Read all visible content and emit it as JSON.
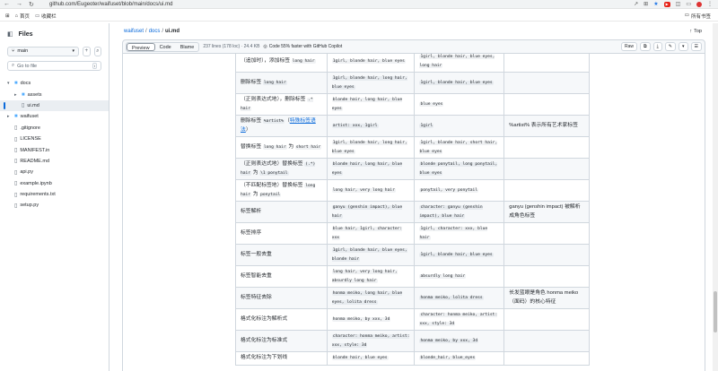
{
  "browser": {
    "url": "github.com/Eugeoter/waifuset/blob/main/docs/ui.md",
    "nav_back": "←",
    "nav_forward": "→",
    "nav_reload": "↻"
  },
  "bookmarks": {
    "home": "首页",
    "favorites": "收藏栏",
    "all": "所有书签"
  },
  "sidebar": {
    "title": "Files",
    "branch": "main",
    "goto_placeholder": "Go to file",
    "goto_kbd": "t",
    "tree": [
      {
        "name": "docs",
        "type": "folder",
        "depth": 0,
        "open": true
      },
      {
        "name": "assets",
        "type": "folder",
        "depth": 1,
        "open": false
      },
      {
        "name": "ui.md",
        "type": "file",
        "depth": 1,
        "selected": true
      },
      {
        "name": "waifuset",
        "type": "folder",
        "depth": 0,
        "open": false
      },
      {
        "name": ".gitignore",
        "type": "file",
        "depth": 0
      },
      {
        "name": "LICENSE",
        "type": "file",
        "depth": 0
      },
      {
        "name": "MANIFEST.in",
        "type": "file",
        "depth": 0
      },
      {
        "name": "README.md",
        "type": "file",
        "depth": 0
      },
      {
        "name": "api.py",
        "type": "file",
        "depth": 0
      },
      {
        "name": "example.ipynb",
        "type": "file",
        "depth": 0
      },
      {
        "name": "requirements.txt",
        "type": "file",
        "depth": 0
      },
      {
        "name": "setup.py",
        "type": "file",
        "depth": 0
      }
    ]
  },
  "breadcrumb": {
    "repo": "waifuset",
    "dir": "docs",
    "file": "ui.md",
    "top": "Top"
  },
  "file_header": {
    "tabs": [
      "Preview",
      "Code",
      "Blame"
    ],
    "active_tab": "Preview",
    "meta": "237 lines (178 loc) · 24.4 KB",
    "copilot": "Code 55% faster with GitHub Copilot",
    "raw": "Raw"
  },
  "table_rows": [
    {
      "c1": [
        "（追加时），添加标签 ",
        {
          "code": "long hair"
        }
      ],
      "c2": [
        {
          "code": "1girl, blonde hair, blue eyes"
        }
      ],
      "c3": [
        {
          "code": "1girl, blonde hair, blue eyes, long hair"
        }
      ],
      "c4": []
    },
    {
      "c1": [
        "删除标签 ",
        {
          "code": "long hair"
        }
      ],
      "c2": [
        {
          "code": "1girl, blonde hair, long hair, blue eyes"
        }
      ],
      "c3": [
        {
          "code": "1girl, blonde hair, blue eyes"
        }
      ],
      "c4": []
    },
    {
      "c1": [
        "（正则表达式地），删除标签 ",
        {
          "code": ".* hair"
        }
      ],
      "c2": [
        {
          "code": "blonde hair, long hair, blue eyes"
        }
      ],
      "c3": [
        {
          "code": "blue eyes"
        }
      ],
      "c4": []
    },
    {
      "c1": [
        "删除标签 ",
        {
          "code": "%artist%"
        },
        "（",
        {
          "link": "特殊标签语法"
        },
        "）"
      ],
      "c2": [
        {
          "code": "artist: xxx, 1girl"
        }
      ],
      "c3": [
        {
          "code": "1girl"
        }
      ],
      "c4": [
        "%artist% 表示所有艺术家标签"
      ]
    },
    {
      "c1": [
        "替换标签 ",
        {
          "code": "long hair"
        },
        " 为 ",
        {
          "code": "short hair"
        }
      ],
      "c2": [
        {
          "code": "1girl, blonde hair, long hair, blue eyes"
        }
      ],
      "c3": [
        {
          "code": "1girl, blonde hair, short hair, blue eyes"
        }
      ],
      "c4": []
    },
    {
      "c1": [
        "（正则表达式地）替换标签 ",
        {
          "code": "(.*) hair"
        },
        " 为 ",
        {
          "code": "\\1 ponytail"
        }
      ],
      "c2": [
        {
          "code": "blonde hair, long hair, blue eyes"
        }
      ],
      "c3": [
        {
          "code": "blonde ponytail, long ponytail, blue eyes"
        }
      ],
      "c4": []
    },
    {
      "c1": [
        "（不匹配标签地）替换标签 ",
        {
          "code": "long hair"
        },
        " 为 ",
        {
          "code": "ponytail"
        }
      ],
      "c2": [
        {
          "code": "long hair, very long hair"
        }
      ],
      "c3": [
        {
          "code": "ponytail, very ponytail"
        }
      ],
      "c4": []
    },
    {
      "c1": [
        "标签解析"
      ],
      "c2": [
        {
          "code": "ganyu (genshin impact), blue hair"
        }
      ],
      "c3": [
        {
          "code": "character: ganyu (genshin impact), blue hair"
        }
      ],
      "c4": [
        "ganyu (genshin impact) 被解析成角色标签"
      ]
    },
    {
      "c1": [
        "标签排序"
      ],
      "c2": [
        {
          "code": "blue hair, 1girl, character: xxx"
        }
      ],
      "c3": [
        {
          "code": "1girl, character: xxx, blue hair"
        }
      ],
      "c4": []
    },
    {
      "c1": [
        "标签一般去重"
      ],
      "c2": [
        {
          "code": "1girl, blonde hair, blue eyes, blonde hair"
        }
      ],
      "c3": [
        {
          "code": "1girl, blonde hair, blue eyes"
        }
      ],
      "c4": []
    },
    {
      "c1": [
        "标签智能去重"
      ],
      "c2": [
        {
          "code": "long hair, very long hair, absurdly long hair"
        }
      ],
      "c3": [
        {
          "code": "absurdly long hair"
        }
      ],
      "c4": []
    },
    {
      "c1": [
        "标签特征去除"
      ],
      "c2": [
        {
          "code": "honma meiko, long hair, blue eyes, lolita dress"
        }
      ],
      "c3": [
        {
          "code": "honma meiko, lolita dress"
        }
      ],
      "c4": [
        "长发蓝眼是角色 honma meiko（面码）的核心特征"
      ]
    },
    {
      "c1": [
        "格式化标注为解析式"
      ],
      "c2": [
        {
          "code": "honma meiko, by xxx, 3d"
        }
      ],
      "c3": [
        {
          "code": "character: honma meiko, artist: xxx, style: 3d"
        }
      ],
      "c4": []
    },
    {
      "c1": [
        "格式化标注为标准式"
      ],
      "c2": [
        {
          "code": "character: honma meiko, artist: xxx, style: 3d"
        }
      ],
      "c3": [
        {
          "code": "honma meiko, by xxx, 3d"
        }
      ],
      "c4": []
    },
    {
      "c1": [
        "格式化标注为下划线"
      ],
      "c2": [
        {
          "code": "blonde hair, blue eyes"
        }
      ],
      "c3": [
        {
          "code": "blonde_hair, blue_eyes"
        }
      ],
      "c4": []
    }
  ]
}
